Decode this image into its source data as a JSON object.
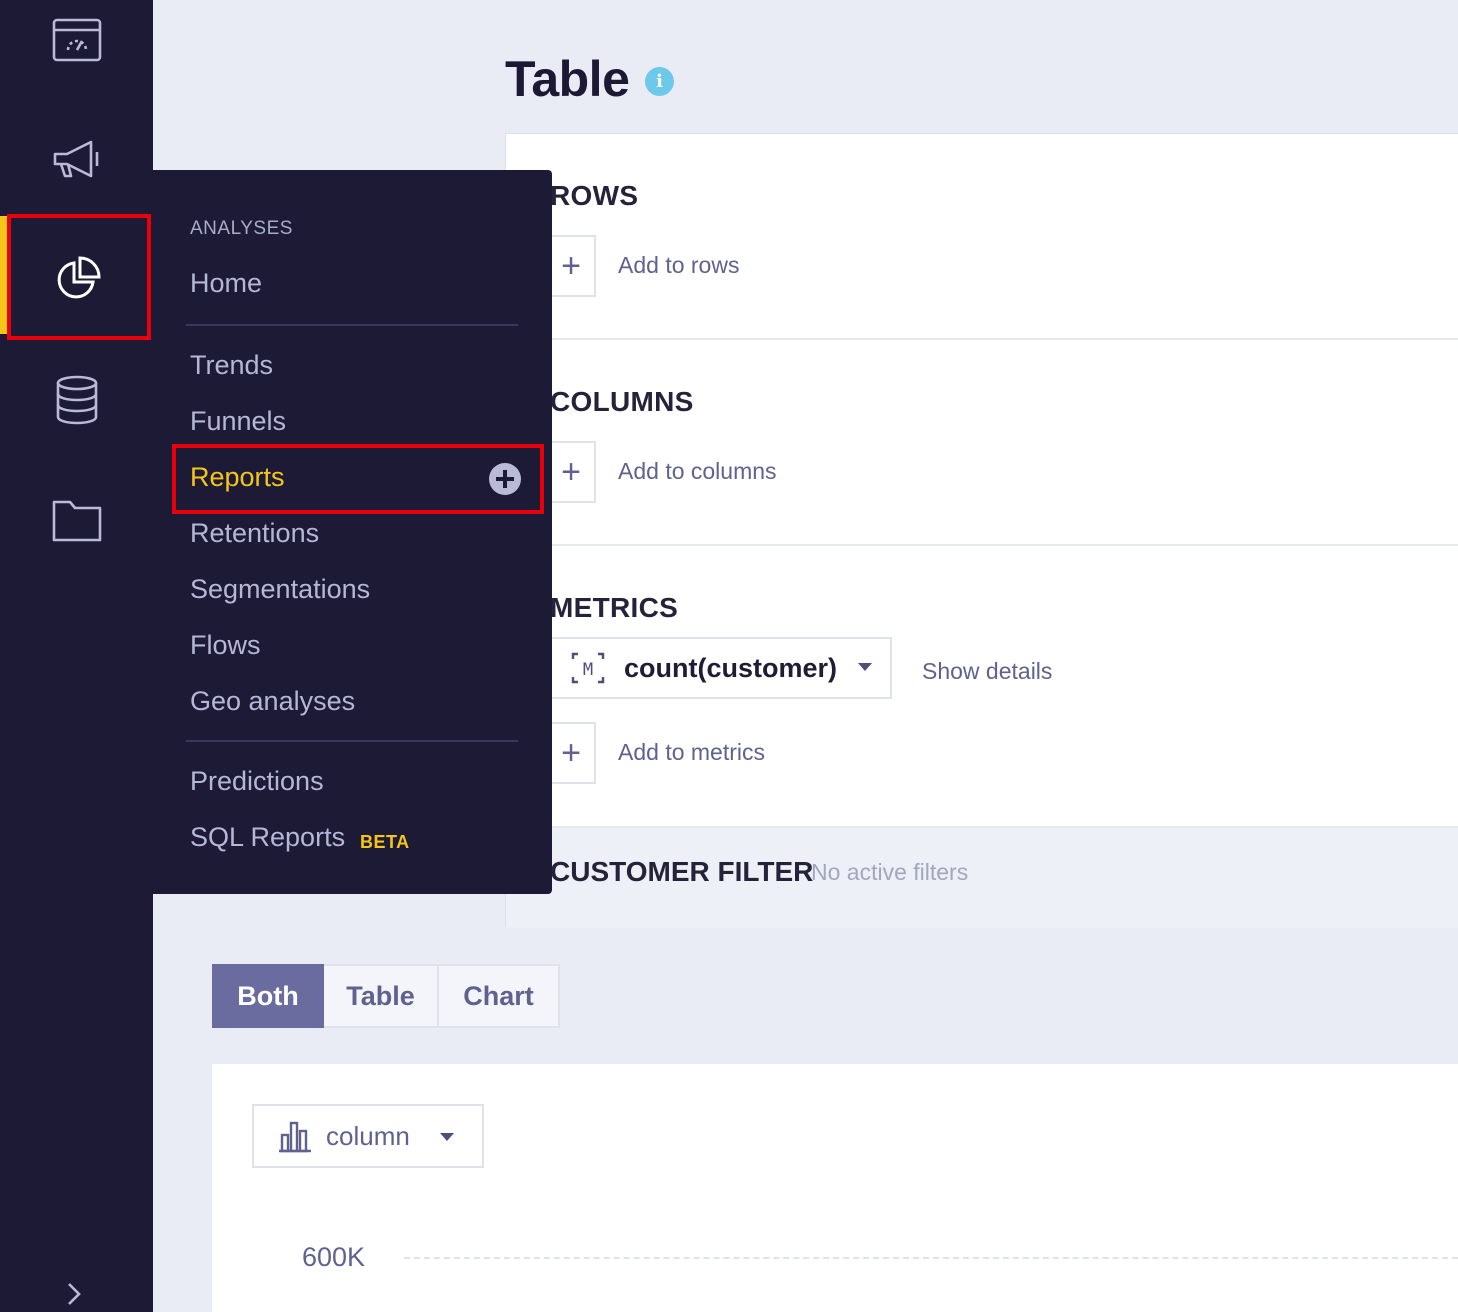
{
  "rail": {
    "items": [
      {
        "name": "dashboard",
        "icon": "dashboard-icon"
      },
      {
        "name": "campaigns",
        "icon": "megaphone-icon"
      },
      {
        "name": "analyses",
        "icon": "pie-chart-icon",
        "active": true
      },
      {
        "name": "data",
        "icon": "database-icon"
      },
      {
        "name": "assets",
        "icon": "folder-icon"
      }
    ],
    "expand_icon": "chevron-right-icon"
  },
  "flyout": {
    "header": "ANALYSES",
    "home": "Home",
    "items": [
      "Trends",
      "Funnels",
      "Reports",
      "Retentions",
      "Segmentations",
      "Flows",
      "Geo analyses"
    ],
    "active_item": "Reports",
    "extra": [
      "Predictions",
      "SQL Reports"
    ],
    "beta_label": "BETA"
  },
  "page": {
    "title": "Table",
    "info_icon": "i"
  },
  "builder": {
    "rows": {
      "title": "ROWS",
      "add_label": "Add to rows"
    },
    "columns": {
      "title": "COLUMNS",
      "add_label": "Add to columns"
    },
    "metrics": {
      "title": "METRICS",
      "metric_value": "count(customer)",
      "show_details": "Show details",
      "add_label": "Add to metrics"
    },
    "filter": {
      "title": "CUSTOMER FILTER",
      "status": "No active filters"
    },
    "add_symbol": "+"
  },
  "view_toggle": {
    "options": [
      "Both",
      "Table",
      "Chart"
    ],
    "selected": "Both"
  },
  "chart": {
    "type_label": "column",
    "y_tick": "600K"
  },
  "colors": {
    "rail_bg": "#1d1a36",
    "accent_yellow": "#f5c518",
    "highlight_red": "#e8000b",
    "info_blue": "#6dc9ea",
    "toggle_active": "#6a6c9f"
  }
}
